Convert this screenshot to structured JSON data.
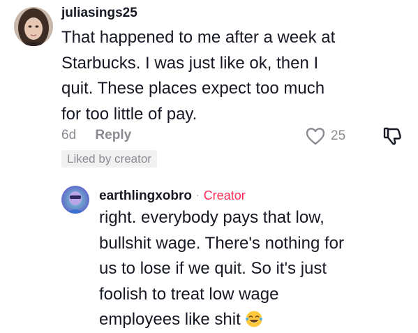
{
  "comment": {
    "username": "juliasings25",
    "avatar_icon": "user-avatar-photo",
    "text_lines": [
      "That happened to me after a week at",
      "Starbucks. I was just like ok, then I",
      "quit. These places expect too much",
      "for too little of pay."
    ],
    "age": "6d",
    "reply_label": "Reply",
    "like_count": "25",
    "like_icon": "heart-outline-icon",
    "dislike_icon": "thumbs-down-icon",
    "badge": "Liked by creator"
  },
  "reply": {
    "username": "earthlingxobro",
    "separator": "·",
    "role": "Creator",
    "avatar_icon": "creator-avatar-photo",
    "text_lines": [
      "right. everybody pays that low,",
      "bullshit wage. There's nothing for",
      "us to lose if we quit. So it's just",
      "foolish to treat low wage",
      "employees like shit"
    ],
    "trailing_emoji": "face-with-tears-of-joy"
  },
  "colors": {
    "text": "#161823",
    "muted": "#8a8b91",
    "creator_accent": "#fe2c55",
    "badge_bg": "#f1f1f2"
  }
}
